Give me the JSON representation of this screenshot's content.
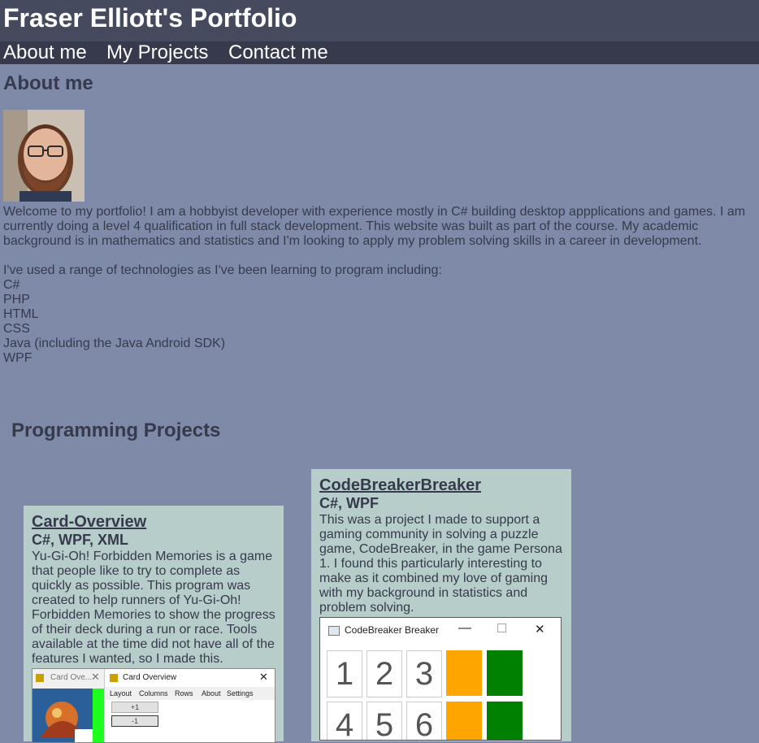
{
  "header": {
    "title": "Fraser Elliott's Portfolio"
  },
  "nav": {
    "items": [
      {
        "label": "About me"
      },
      {
        "label": "My Projects"
      },
      {
        "label": "Contact me"
      }
    ]
  },
  "about": {
    "heading": "About me",
    "intro": "Welcome to my portfolio! I am a hobbyist developer with experience mostly in C# building desktop appplications and games. I am currently doing a level 4 qualification in full stack development. This website was built as part of the course. My academic background is in mathematics and statistics and I'm looking to apply my problem solving skills in a career in development.",
    "tech_intro": "I've used a range of technologies as I've been learning to program including:",
    "technologies": [
      "C#",
      "PHP",
      "HTML",
      "CSS",
      "Java (including the Java Android SDK)",
      "WPF"
    ]
  },
  "projects": {
    "heading": "Programming Projects",
    "items": [
      {
        "title": "Card-Overview",
        "tech": "C#, WPF, XML",
        "description": "Yu-Gi-Oh! Forbidden Memories is a game that people like to try to complete as quickly as possible. This program was created to help runners of Yu-Gi-Oh! Forbidden Memories to show the progress of their deck during a run or race. Tools available at the time did not have all of the features I wanted, so I made this.",
        "screenshot": {
          "tab_left": "Card Ove...",
          "window_title": "Card Overview",
          "menu": [
            "Layout",
            "Columns",
            "Rows",
            "About",
            "Settings"
          ],
          "btn_plus": "+1",
          "btn_minus": "-1"
        }
      },
      {
        "title": "CodeBreakerBreaker",
        "tech": "C#, WPF",
        "description": "This was a project I made to support a gaming community in solving a puzzle game, CodeBreaker, in the game Persona 1. I found this particularly interesting to make as it combined my love of gaming with my background in statistics and problem solving.",
        "screenshot": {
          "window_title": "CodeBreaker Breaker",
          "row1": [
            "1",
            "2",
            "3"
          ],
          "row2": [
            "4",
            "5",
            "6"
          ],
          "colors": {
            "orange": "#ffa500",
            "green": "#008000"
          }
        }
      }
    ]
  }
}
